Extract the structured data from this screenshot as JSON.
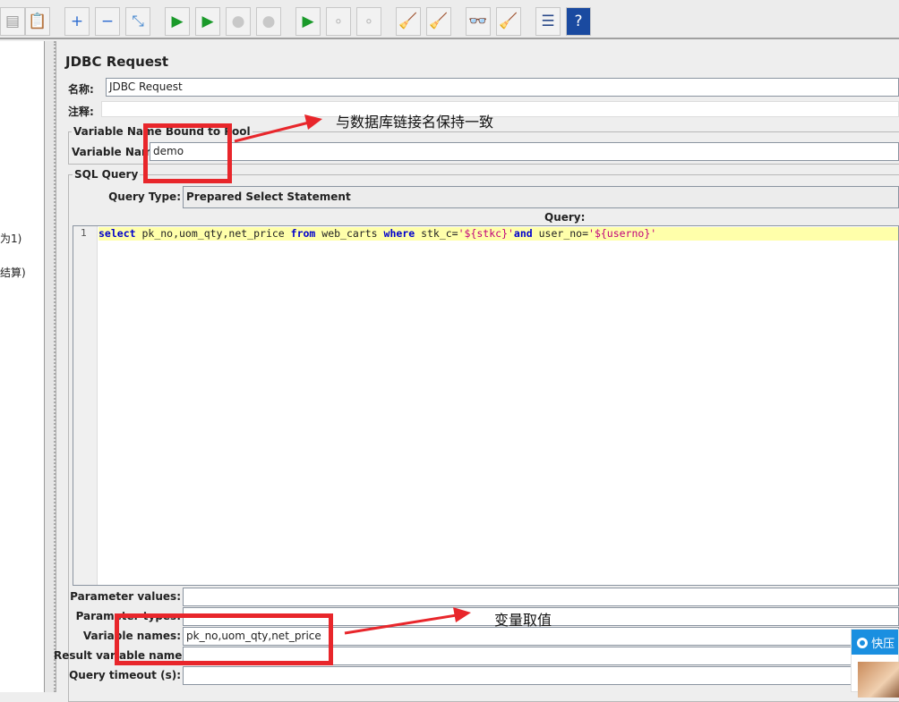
{
  "toolbar": {
    "icons": [
      "copy-icon",
      "paste-icon",
      "expand-icon",
      "collapse-icon",
      "toggle-icon",
      "start-icon",
      "start-no-pause-icon",
      "stop-icon",
      "shutdown-icon",
      "remote-start-icon",
      "remote-stop-icon",
      "remote-shutdown-icon",
      "clear-icon",
      "clear-all-icon",
      "search-icon",
      "reset-search-icon",
      "function-helper-icon",
      "help-icon"
    ]
  },
  "tree": {
    "items": [
      "为1)",
      "结算)"
    ]
  },
  "panel": {
    "title": "JDBC Request",
    "name_label": "名称:",
    "name_value": "JDBC Request",
    "comment_label": "注释:",
    "comment_value": "",
    "pool_legend": "Variable Name Bound to Pool",
    "pool_label": "Variable Name",
    "pool_value": "demo",
    "sql_legend": "SQL Query",
    "query_type_label": "Query Type:",
    "query_type_value": "Prepared Select Statement",
    "query_header": "Query:",
    "line_number": "1",
    "query_tokens": [
      {
        "t": "select",
        "c": "kw"
      },
      {
        "t": " pk_no,uom_qty,net_price ",
        "c": ""
      },
      {
        "t": "from",
        "c": "kw"
      },
      {
        "t": " web_carts ",
        "c": ""
      },
      {
        "t": "where",
        "c": "kw"
      },
      {
        "t": " stk_c=",
        "c": ""
      },
      {
        "t": "'${stkc}'",
        "c": "st"
      },
      {
        "t": "and",
        "c": "kw"
      },
      {
        "t": " user_no=",
        "c": ""
      },
      {
        "t": "'${userno}'",
        "c": "st"
      }
    ],
    "params": [
      {
        "label": "Parameter values:",
        "value": ""
      },
      {
        "label": "Parameter types:",
        "value": ""
      },
      {
        "label": "Variable names:",
        "value": "pk_no,uom_qty,net_price"
      },
      {
        "label": "Result variable name:",
        "value": ""
      },
      {
        "label": "Query timeout (s):",
        "value": ""
      }
    ]
  },
  "annotations": {
    "pool_note": "与数据库链接名保持一致",
    "vars_note": "变量取值",
    "color": "#e8262b"
  },
  "popup": {
    "title": "快压",
    "header_color": "#1a8fe0"
  }
}
